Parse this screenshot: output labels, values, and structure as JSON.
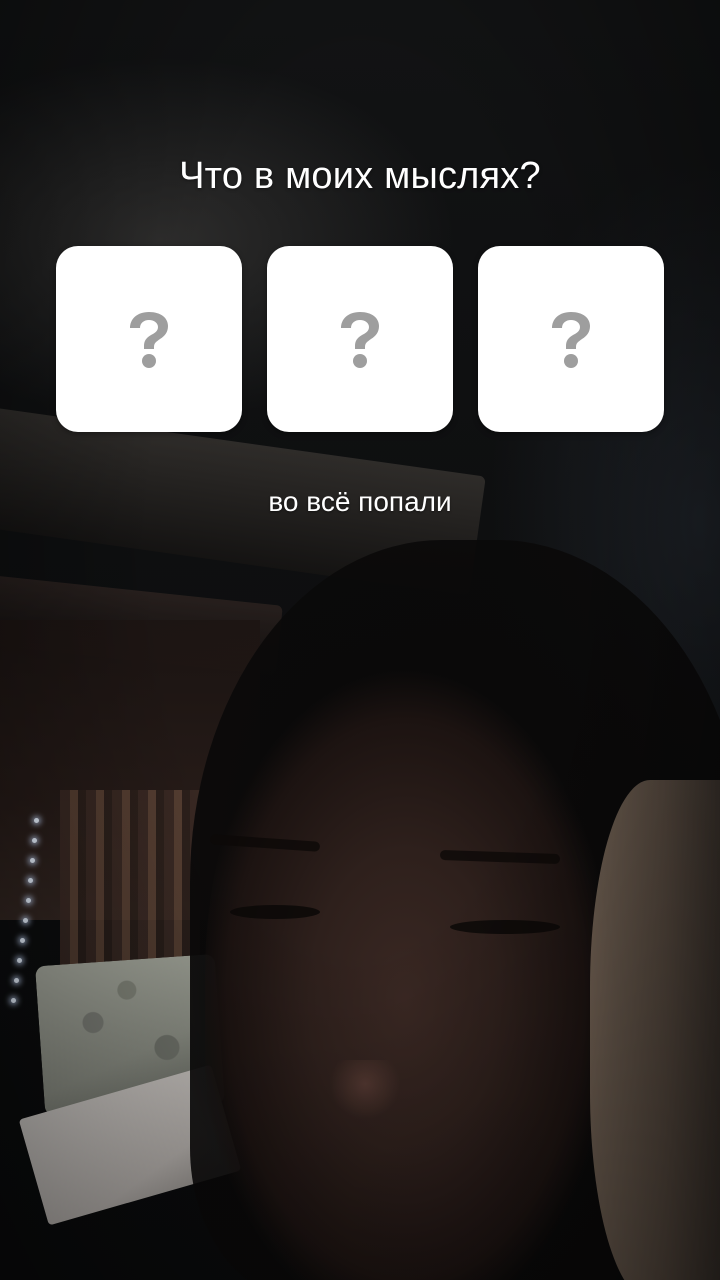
{
  "question": {
    "title": "Что в моих мыслях?"
  },
  "tiles": [
    {
      "icon": "question-mark-icon",
      "color": "#9e9e9e"
    },
    {
      "icon": "question-mark-icon",
      "color": "#9e9e9e"
    },
    {
      "icon": "question-mark-icon",
      "color": "#9e9e9e"
    }
  ],
  "caption": {
    "text": "во всё попали"
  },
  "colors": {
    "tile_background": "#ffffff",
    "text": "#ffffff"
  }
}
